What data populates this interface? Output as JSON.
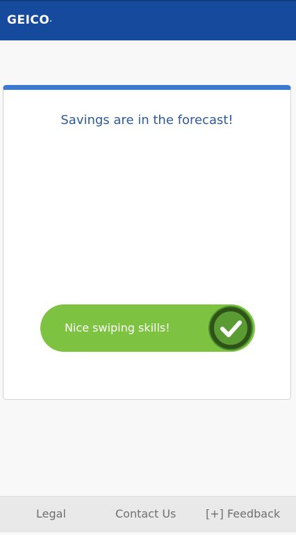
{
  "header": {
    "logo_text": "GEICO",
    "logo_dot": ".",
    "background_color": "#154a9c"
  },
  "card": {
    "title": "Savings are in the forecast!",
    "accent_color": "#3b79d3"
  },
  "swipe_control": {
    "label": "Nice swiping skills!",
    "progress": 1.0,
    "icon": "checkmark-icon",
    "color": "#7dc241"
  },
  "footer": {
    "links": [
      {
        "label": "Legal"
      },
      {
        "label": "Contact Us"
      },
      {
        "label": "[+] Feedback"
      }
    ]
  }
}
